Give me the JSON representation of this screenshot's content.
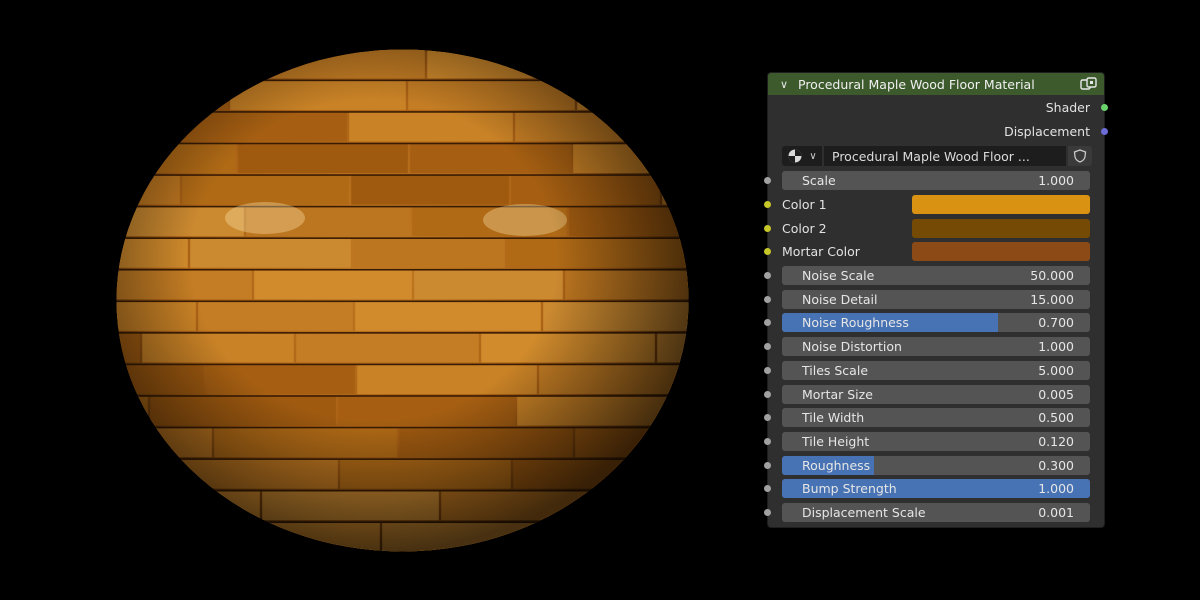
{
  "node": {
    "title": "Procedural Maple Wood Floor Material",
    "outputs": [
      {
        "label": "Shader",
        "socket_color": "#6bd36b"
      },
      {
        "label": "Displacement",
        "socket_color": "#6c6cd6"
      }
    ],
    "group_name": "Procedural Maple Wood Floor ...",
    "inputs": [
      {
        "kind": "value",
        "label": "Scale",
        "value": "1.000",
        "fill": 0
      },
      {
        "kind": "color",
        "label": "Color 1",
        "color": "#d99211"
      },
      {
        "kind": "color",
        "label": "Color 2",
        "color": "#744a04"
      },
      {
        "kind": "color",
        "label": "Mortar Color",
        "color": "#8c4a16"
      },
      {
        "kind": "value",
        "label": "Noise Scale",
        "value": "50.000",
        "fill": 0
      },
      {
        "kind": "value",
        "label": "Noise Detail",
        "value": "15.000",
        "fill": 0
      },
      {
        "kind": "value",
        "label": "Noise Roughness",
        "value": "0.700",
        "fill": 0.7
      },
      {
        "kind": "value",
        "label": "Noise Distortion",
        "value": "1.000",
        "fill": 0
      },
      {
        "kind": "value",
        "label": "Tiles Scale",
        "value": "5.000",
        "fill": 0
      },
      {
        "kind": "value",
        "label": "Mortar Size",
        "value": "0.005",
        "fill": 0
      },
      {
        "kind": "value",
        "label": "Tile Width",
        "value": "0.500",
        "fill": 0
      },
      {
        "kind": "value",
        "label": "Tile Height",
        "value": "0.120",
        "fill": 0
      },
      {
        "kind": "value",
        "label": "Roughness",
        "value": "0.300",
        "fill": 0.3
      },
      {
        "kind": "value",
        "label": "Bump Strength",
        "value": "1.000",
        "fill": 1.0
      },
      {
        "kind": "value",
        "label": "Displacement Scale",
        "value": "0.001",
        "fill": 0
      }
    ]
  },
  "colors": {
    "header": "#3c5a2c",
    "slider_fill": "#4772b3",
    "value_socket": "#a1a1a1",
    "color_socket": "#c7c729"
  }
}
